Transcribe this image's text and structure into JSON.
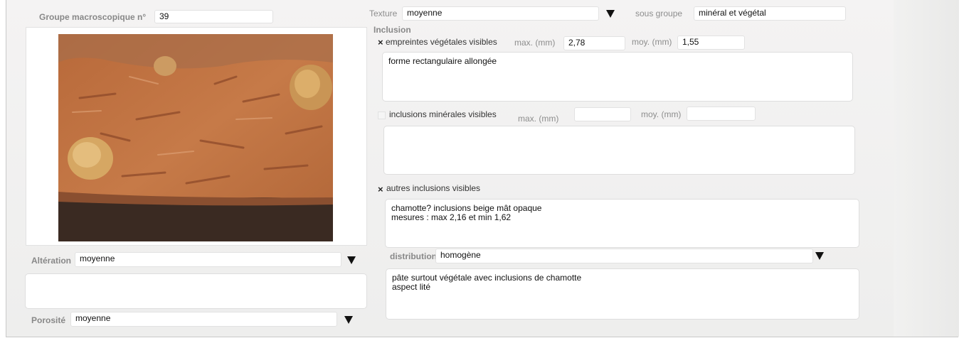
{
  "groupe": {
    "label": "Groupe macroscopique n°",
    "value": "39"
  },
  "texture": {
    "label": "Texture",
    "value": "moyenne"
  },
  "sous_groupe": {
    "label": "sous groupe",
    "value": "minéral et végétal"
  },
  "inclusion": {
    "title": "Inclusion",
    "empreintes": {
      "checked_mark": "×",
      "label": "empreintes végétales visibles",
      "max_label": "max. (mm)",
      "max_value": "2,78",
      "moy_label": "moy. (mm)",
      "moy_value": "1,55",
      "notes": "forme rectangulaire allongée"
    },
    "minerales": {
      "label": "inclusions minérales visibles",
      "max_label": "max. (mm)",
      "max_value": "",
      "moy_label": "moy. (mm)",
      "moy_value": "",
      "notes": ""
    },
    "autres": {
      "checked_mark": "×",
      "label": "autres inclusions visibles",
      "notes": "chamotte? inclusions beige mât opaque\nmesures : max 2,16 et min 1,62"
    }
  },
  "distribution": {
    "label": "distribution",
    "value": "homogène"
  },
  "commentaire": "pâte surtout végétale avec inclusions de chamotte\naspect lité",
  "alteration": {
    "label": "Altération",
    "value": "moyenne",
    "notes": ""
  },
  "porosite": {
    "label": "Porosité",
    "value": "moyenne"
  },
  "icons": {
    "dropdown": "triangle-down-icon",
    "checkbox": "x-mark"
  }
}
